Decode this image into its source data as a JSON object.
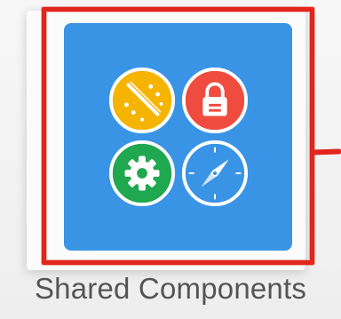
{
  "app_tile": {
    "label": "Shared Components",
    "background_color": "#3a94e6",
    "icons": [
      {
        "name": "wand-icon",
        "color": "#f4b400"
      },
      {
        "name": "lock-icon",
        "color": "#ef4b3f"
      },
      {
        "name": "gear-icon",
        "color": "#1fa84f"
      },
      {
        "name": "compass-icon",
        "color": "#3a94e6"
      }
    ]
  },
  "highlight_color": "#e1261c"
}
